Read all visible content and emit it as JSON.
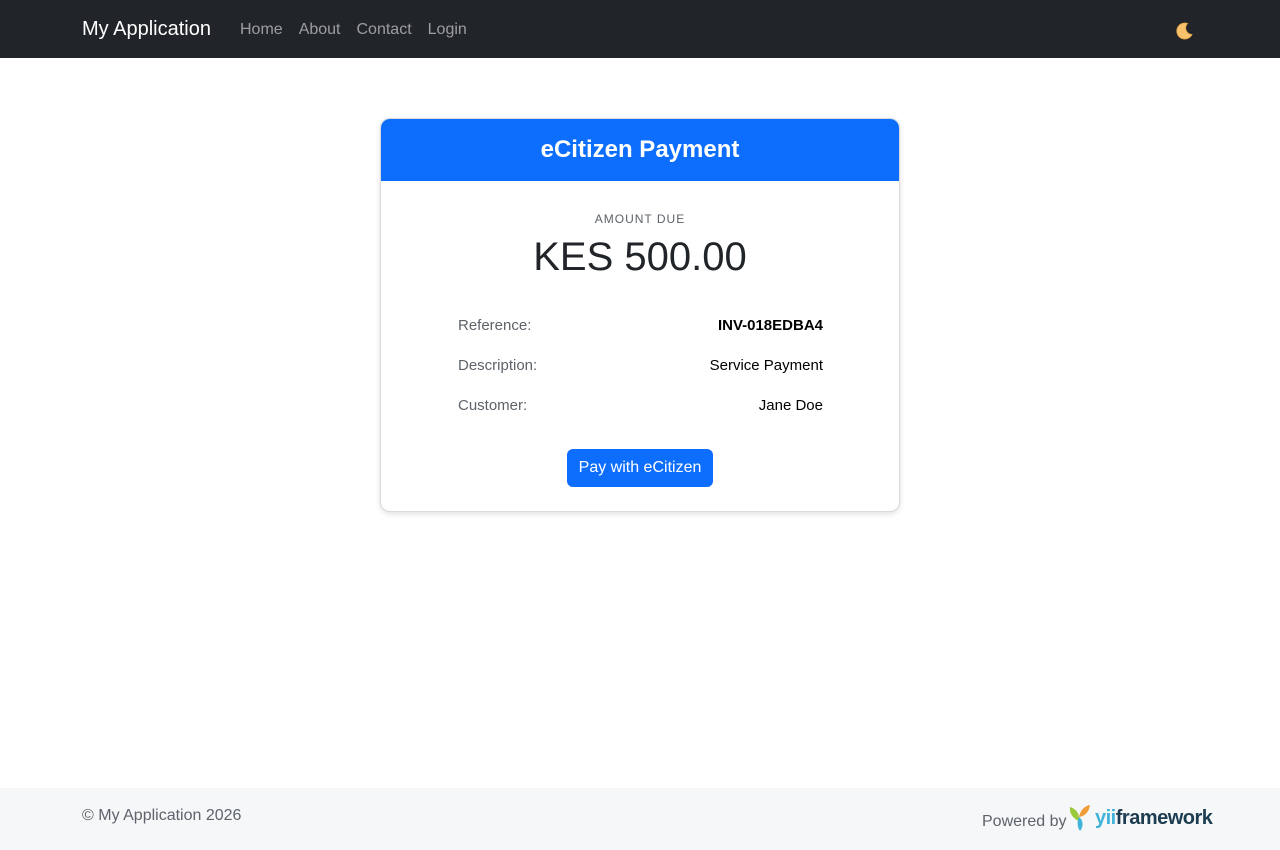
{
  "navbar": {
    "brand": "My Application",
    "links": [
      "Home",
      "About",
      "Contact",
      "Login"
    ],
    "theme_icon": "moon-icon"
  },
  "card": {
    "title": "eCitizen Payment",
    "amount_label": "AMOUNT DUE",
    "amount_value": "KES 500.00",
    "details": [
      {
        "label": "Reference:",
        "value": "INV-018EDBA4"
      },
      {
        "label": "Description:",
        "value": "Service Payment"
      },
      {
        "label": "Customer:",
        "value": "Jane Doe"
      }
    ],
    "pay_button": "Pay with eCitizen"
  },
  "footer": {
    "copyright": "© My Application 2026",
    "powered_by": "Powered by",
    "logo_text": "yiiframework"
  },
  "colors": {
    "navbar_bg": "#212529",
    "primary": "#0d6efd",
    "footer_bg": "#f6f7f9"
  }
}
